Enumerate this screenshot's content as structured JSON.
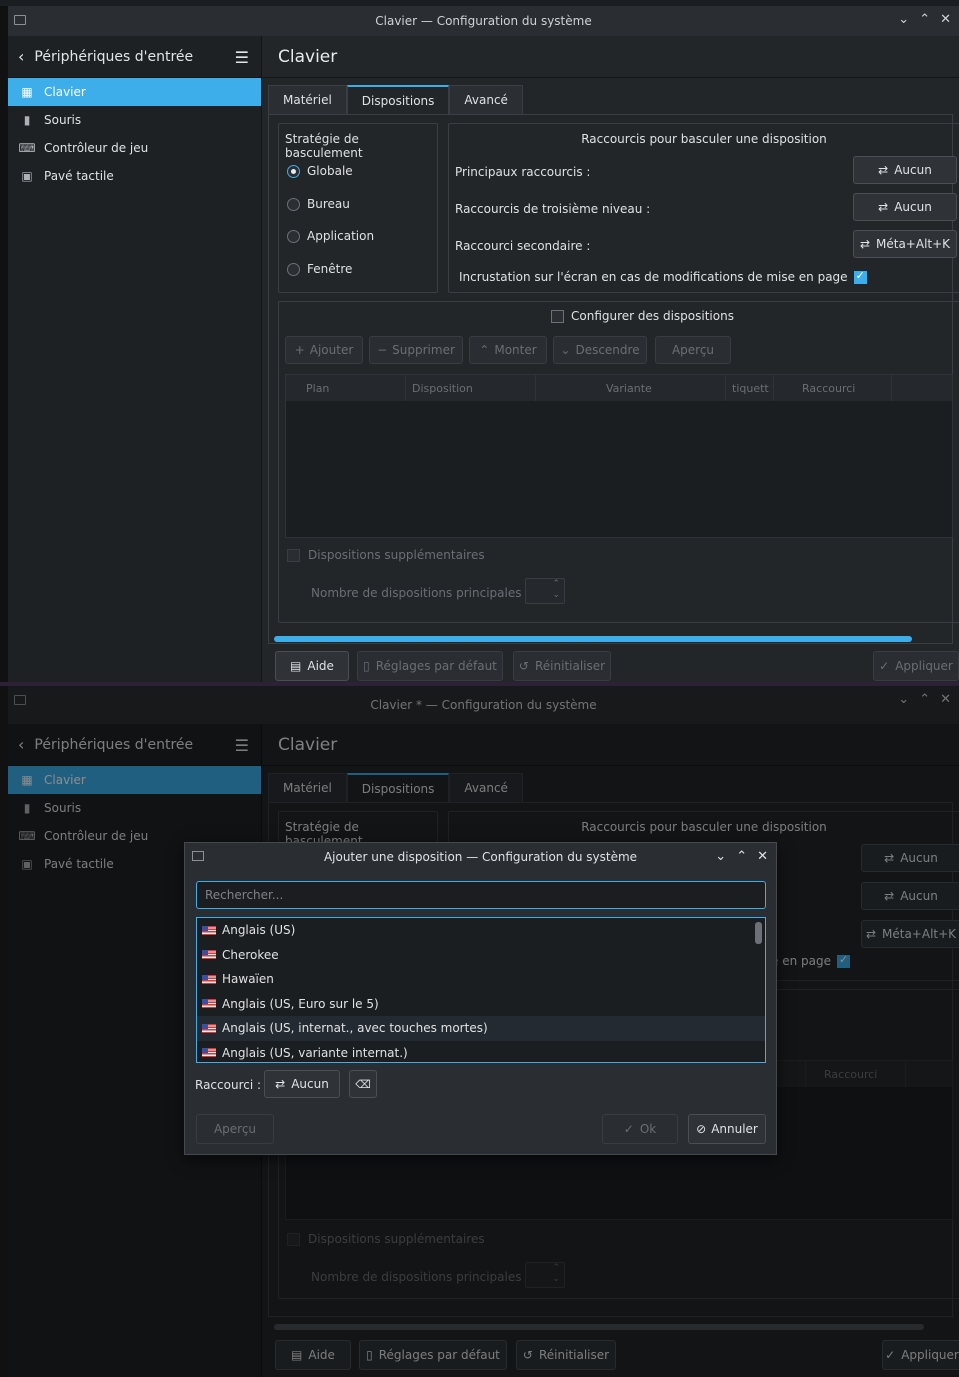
{
  "window1": {
    "title": "Clavier — Configuration du système",
    "sidebar": {
      "header": "Périphériques d'entrée",
      "items": [
        {
          "label": "Clavier",
          "icon": "keyboard-icon"
        },
        {
          "label": "Souris",
          "icon": "mouse-icon"
        },
        {
          "label": "Contrôleur de jeu",
          "icon": "gamepad-icon"
        },
        {
          "label": "Pavé tactile",
          "icon": "touchpad-icon"
        }
      ]
    },
    "page_title": "Clavier",
    "tabs": [
      "Matériel",
      "Dispositions",
      "Avancé"
    ],
    "switching": {
      "title": "Stratégie de basculement",
      "options": [
        "Globale",
        "Bureau",
        "Application",
        "Fenêtre"
      ],
      "selected": "Globale"
    },
    "shortcuts": {
      "title": "Raccourcis pour basculer une disposition",
      "main_label": "Principaux raccourcis :",
      "main_value": "Aucun",
      "third_label": "Raccourcis de troisième niveau :",
      "third_value": "Aucun",
      "secondary_label": "Raccourci secondaire :",
      "secondary_value": "Méta+Alt+K",
      "osd_label": "Incrustation sur l'écran en cas de modifications de mise en page"
    },
    "layouts": {
      "configure_label": "Configurer des dispositions",
      "buttons": [
        "Ajouter",
        "Supprimer",
        "Monter",
        "Descendre",
        "Aperçu"
      ],
      "columns": [
        "Plan",
        "Disposition",
        "Variante",
        "tiquett",
        "Raccourci"
      ],
      "extra_label": "Dispositions supplémentaires",
      "count_label": "Nombre de dispositions principales :"
    },
    "footer": {
      "help": "Aide",
      "defaults": "Réglages par défaut",
      "reset": "Réinitialiser",
      "apply": "Appliquer"
    }
  },
  "window2": {
    "title": "Clavier * — Configuration du système",
    "sidebar_header": "Périphériques d'entrée",
    "sidebar_items": [
      "Clavier",
      "Souris",
      "Contrôleur de jeu",
      "Pavé tactile"
    ],
    "page_title": "Clavier",
    "tabs": [
      "Matériel",
      "Dispositions",
      "Avancé"
    ],
    "switching_title": "Stratégie de basculement",
    "shortcuts_title": "Raccourcis pour basculer une disposition",
    "btn_main": "Aucun",
    "btn_third": "Aucun",
    "btn_secondary": "Méta+Alt+K",
    "osd_fragment": "e en page",
    "col_shortcut": "Raccourci",
    "extra_label": "Dispositions supplémentaires",
    "count_label": "Nombre de dispositions principales :",
    "footer": {
      "help": "Aide",
      "defaults": "Réglages par défaut",
      "reset": "Réinitialiser",
      "apply": "Appliquer"
    }
  },
  "dialog": {
    "title": "Ajouter une disposition — Configuration du système",
    "search_placeholder": "Rechercher...",
    "items": [
      "Anglais (US)",
      "Cherokee",
      "Hawaïen",
      "Anglais (US, Euro sur le 5)",
      "Anglais (US, internat., avec touches mortes)",
      "Anglais (US, variante internat.)"
    ],
    "shortcut_label": "Raccourci :",
    "shortcut_value": "Aucun",
    "preview": "Aperçu",
    "ok": "Ok",
    "cancel": "Annuler"
  },
  "colors": {
    "accent": "#3daee9",
    "background": "#232629",
    "sidebar": "#1e2124"
  }
}
